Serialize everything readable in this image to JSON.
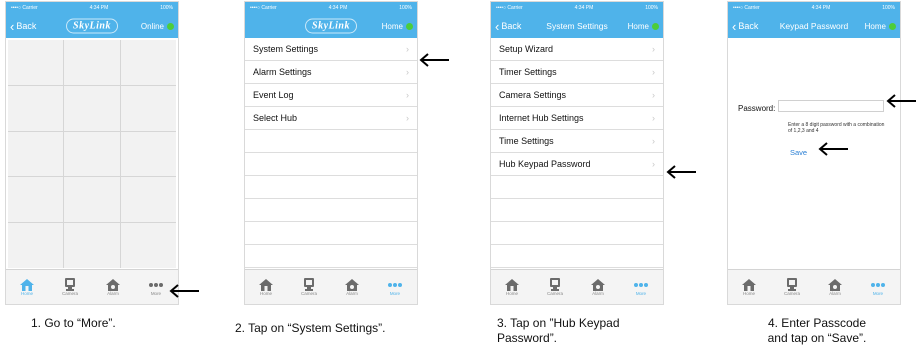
{
  "status_bar": {
    "carrier": "••••○ Carrier",
    "time": "4:34 PM",
    "battery": "100%"
  },
  "tabs": [
    {
      "label": "Home",
      "icon": "home-icon"
    },
    {
      "label": "Camera",
      "icon": "camera-icon"
    },
    {
      "label": "Alarm",
      "icon": "alarm-icon"
    },
    {
      "label": "More",
      "icon": "more-icon"
    }
  ],
  "screens": [
    {
      "back": "Back",
      "logo": "SkyLink",
      "right": "Online",
      "active_tab": "Home",
      "caption": "1. Go to “More”."
    },
    {
      "logo": "SkyLink",
      "right": "Home",
      "active_tab": "More",
      "items": [
        "System Settings",
        "Alarm Settings",
        "Event Log",
        "Select Hub"
      ],
      "caption": "2. Tap on “System Settings”."
    },
    {
      "back": "Back",
      "title": "System Settings",
      "right": "Home",
      "active_tab": "More",
      "items": [
        "Setup Wizard",
        "Timer Settings",
        "Camera Settings",
        "Internet Hub Settings",
        "Time Settings",
        "Hub Keypad Password"
      ],
      "caption_lines": [
        "3. Tap on ”Hub Keypad",
        "Password”."
      ]
    },
    {
      "back": "Back",
      "title": "Keypad Password",
      "right": "Home",
      "active_tab": "More",
      "password_label": "Password:",
      "password_value": "",
      "hint": "Enter a 8 digit password with a combination of 1,2,3 and 4",
      "save": "Save",
      "caption_lines": [
        "4. Enter Passcode",
        "and tap on “Save”."
      ]
    }
  ],
  "colors": {
    "bar": "#4fb3ea",
    "online": "#4ccd3a",
    "arrow": "#000000"
  }
}
